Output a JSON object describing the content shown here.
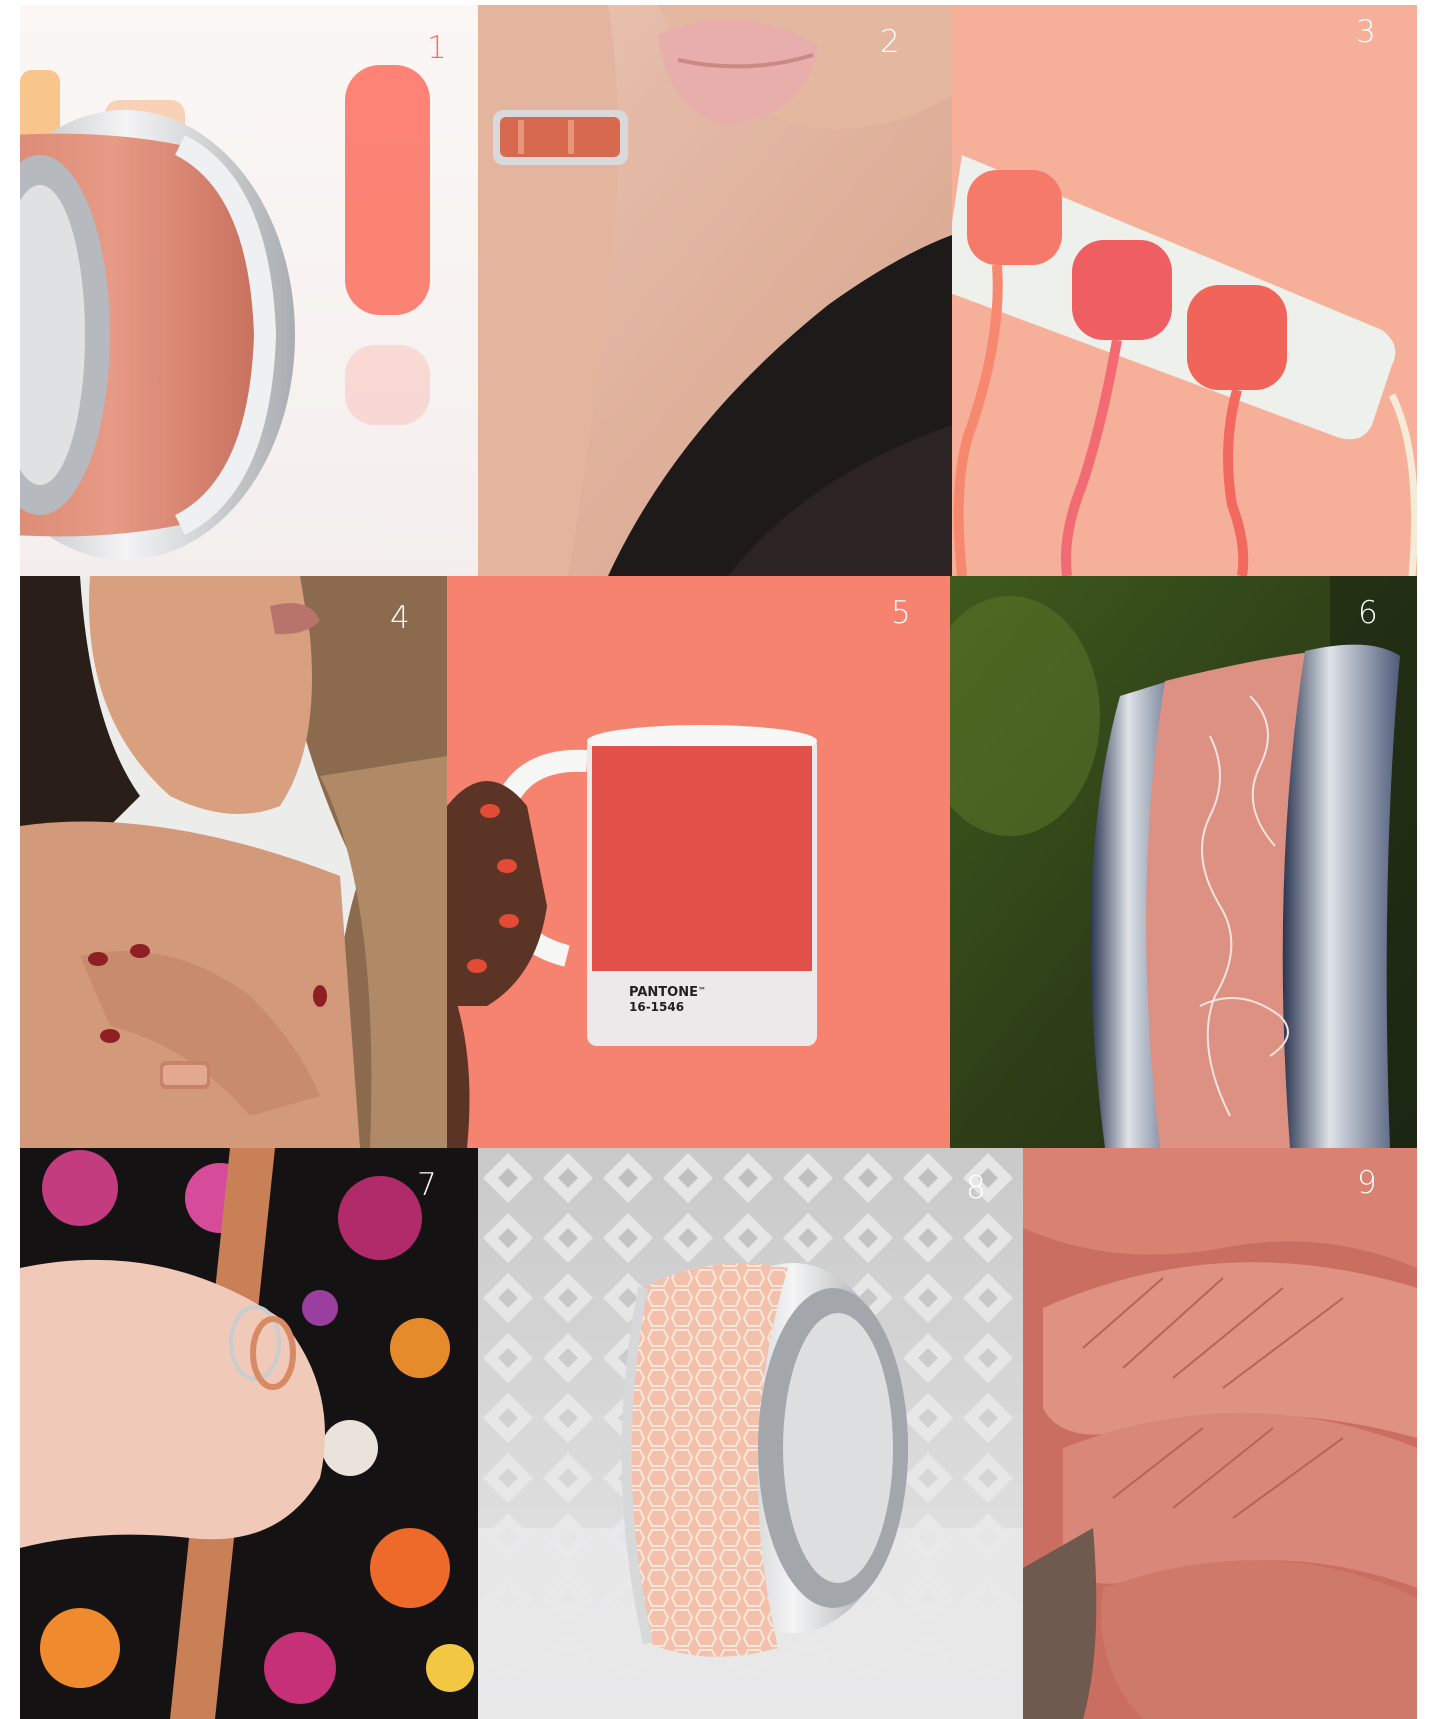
{
  "collage": {
    "tiles": [
      {
        "number": "1",
        "subject": "ring"
      },
      {
        "number": "2",
        "subject": "ring-on-hand"
      },
      {
        "number": "3",
        "subject": "power-strip"
      },
      {
        "number": "4",
        "subject": "woman-ring"
      },
      {
        "number": "5",
        "subject": "mug",
        "mug_brand": "PANTONE",
        "mug_tm": "™",
        "mug_code": "16-1546"
      },
      {
        "number": "6",
        "subject": "coral-ring"
      },
      {
        "number": "7",
        "subject": "floral-ring"
      },
      {
        "number": "8",
        "subject": "pattern-ring"
      },
      {
        "number": "9",
        "subject": "mushroom"
      }
    ]
  },
  "colors": {
    "coral": "#f6826f",
    "coral_dark": "#e35d4f",
    "peach": "#f3b3a0",
    "silver": "#d8dadc",
    "number_red": "#ff6b63"
  }
}
